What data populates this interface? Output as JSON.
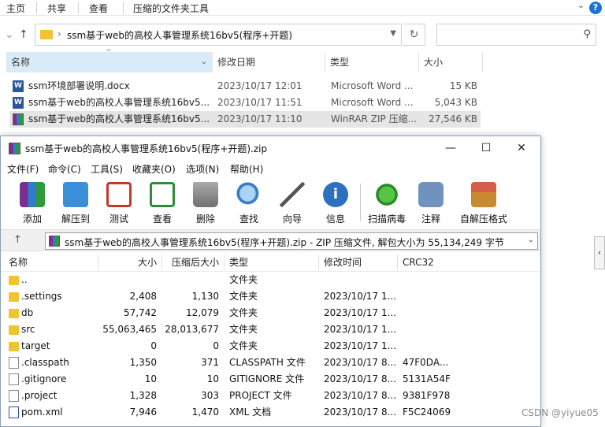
{
  "explorer": {
    "ribbon_tabs": [
      "主页",
      "共享",
      "查看",
      "压缩的文件夹工具"
    ],
    "address_path": "ssm基于web的高校人事管理系统16bv5(程序+开题)",
    "columns": {
      "name": "名称",
      "modified": "修改日期",
      "type": "类型",
      "size": "大小"
    },
    "files": [
      {
        "name": "ssm环境部署说明.docx",
        "modified": "2023/10/17 12:01",
        "type": "Microsoft Word ...",
        "size": "15 KB",
        "icon": "word-icon"
      },
      {
        "name": "ssm基于web的高校人事管理系统16bv5...",
        "modified": "2023/10/17 11:51",
        "type": "Microsoft Word ...",
        "size": "5,043 KB",
        "icon": "word-icon"
      },
      {
        "name": "ssm基于web的高校人事管理系统16bv5...",
        "modified": "2023/10/17 11:10",
        "type": "WinRAR ZIP 压缩...",
        "size": "27,546 KB",
        "icon": "winrar-icon"
      }
    ]
  },
  "winrar": {
    "title": "ssm基于web的高校人事管理系统16bv5(程序+开题).zip",
    "menu": [
      "文件(F)",
      "命令(C)",
      "工具(S)",
      "收藏夹(O)",
      "选项(N)",
      "帮助(H)"
    ],
    "toolbar": [
      {
        "label": "添加",
        "icon": "add-archive-icon",
        "color": "#7b2f8f"
      },
      {
        "label": "解压到",
        "icon": "extract-folder-icon",
        "color": "#3b8fd9"
      },
      {
        "label": "测试",
        "icon": "test-clipboard-icon",
        "color": "#c0392b"
      },
      {
        "label": "查看",
        "icon": "view-book-icon",
        "color": "#2e8b3a"
      },
      {
        "label": "删除",
        "icon": "trash-icon",
        "color": "#8a8a8a"
      },
      {
        "label": "查找",
        "icon": "magnifier-icon",
        "color": "#3a7fc4"
      },
      {
        "label": "向导",
        "icon": "wizard-wand-icon",
        "color": "#6a6a6a"
      },
      {
        "label": "信息",
        "icon": "info-icon",
        "color": "#2f6fbf"
      },
      {
        "label": "扫描病毒",
        "icon": "virus-scan-icon",
        "color": "#35a83a"
      },
      {
        "label": "注释",
        "icon": "comment-icon",
        "color": "#5b7fa8"
      },
      {
        "label": "自解压格式",
        "icon": "sfx-box-icon",
        "color": "#c9892e"
      }
    ],
    "path_text": "ssm基于web的高校人事管理系统16bv5(程序+开题).zip - ZIP 压缩文件, 解包大小为 55,134,249 字节",
    "columns": {
      "name": "名称",
      "size": "大小",
      "packed": "压缩后大小",
      "type": "类型",
      "modified": "修改时间",
      "crc": "CRC32"
    },
    "rows": [
      {
        "name": "..",
        "size": "",
        "packed": "",
        "type": "文件夹",
        "modified": "",
        "crc": "",
        "kind": "folder"
      },
      {
        "name": ".settings",
        "size": "2,408",
        "packed": "1,130",
        "type": "文件夹",
        "modified": "2023/10/17 1...",
        "crc": "",
        "kind": "folder"
      },
      {
        "name": "db",
        "size": "57,742",
        "packed": "12,079",
        "type": "文件夹",
        "modified": "2023/10/17 1...",
        "crc": "",
        "kind": "folder"
      },
      {
        "name": "src",
        "size": "55,063,465",
        "packed": "28,013,677",
        "type": "文件夹",
        "modified": "2023/10/17 1...",
        "crc": "",
        "kind": "folder"
      },
      {
        "name": "target",
        "size": "0",
        "packed": "0",
        "type": "文件夹",
        "modified": "2023/10/17 1...",
        "crc": "",
        "kind": "folder"
      },
      {
        "name": ".classpath",
        "size": "1,350",
        "packed": "371",
        "type": "CLASSPATH 文件",
        "modified": "2023/10/17 8...",
        "crc": "47F0DA...",
        "kind": "file"
      },
      {
        "name": ".gitignore",
        "size": "10",
        "packed": "10",
        "type": "GITIGNORE 文件",
        "modified": "2023/10/17 8...",
        "crc": "5131A54F",
        "kind": "file"
      },
      {
        "name": ".project",
        "size": "1,328",
        "packed": "303",
        "type": "PROJECT 文件",
        "modified": "2023/10/17 8...",
        "crc": "9381F978",
        "kind": "file"
      },
      {
        "name": "pom.xml",
        "size": "7,946",
        "packed": "1,470",
        "type": "XML 文档",
        "modified": "2023/10/17 8...",
        "crc": "F5C24069",
        "kind": "xml"
      }
    ]
  },
  "watermark": "CSDN @yiyue05"
}
